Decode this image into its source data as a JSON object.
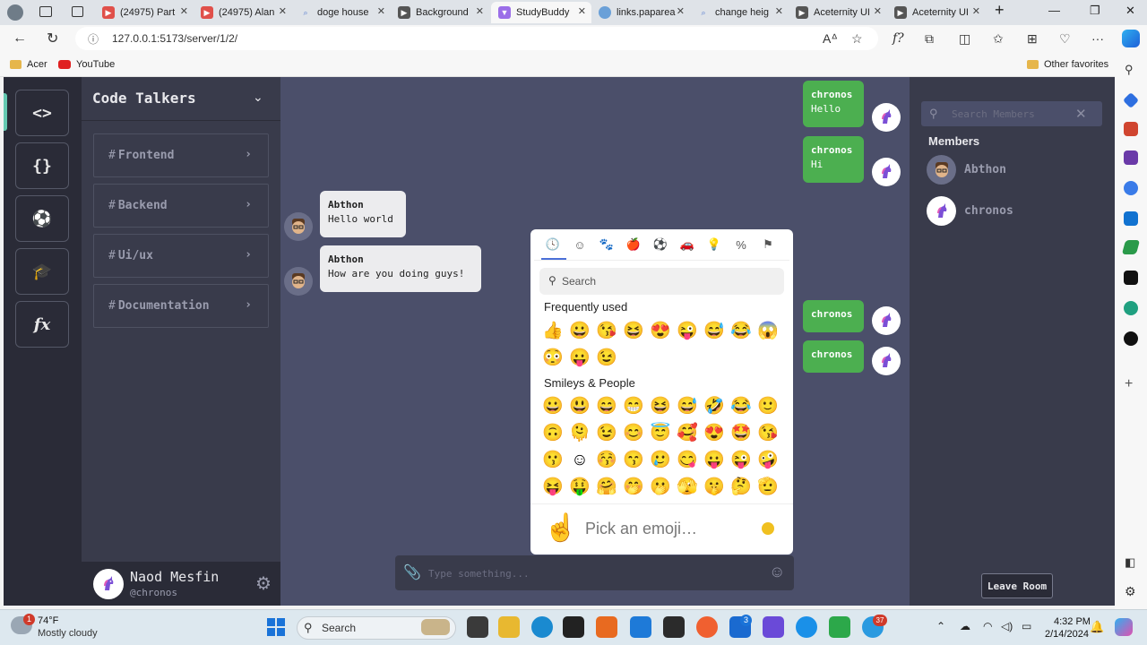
{
  "browser": {
    "tabs": [
      {
        "label": "(24975) Part",
        "icon_color": "#e0504a"
      },
      {
        "label": "(24975) Alan",
        "icon_color": "#e0504a"
      },
      {
        "label": "doge house",
        "icon_color": "#5a7fd0"
      },
      {
        "label": "Background",
        "icon_color": "#555555"
      },
      {
        "label": "StudyBuddy",
        "icon_color": "#9b6ee8"
      },
      {
        "label": "links.paparea",
        "icon_color": "#6aa0d8"
      },
      {
        "label": "change heig",
        "icon_color": "#5a7fd0"
      },
      {
        "label": "Aceternity UI",
        "icon_color": "#555555"
      },
      {
        "label": "Aceternity UI",
        "icon_color": "#555555"
      }
    ],
    "url": "127.0.0.1:5173/server/1/2/",
    "bookmarks": [
      "Acer",
      "YouTube"
    ],
    "other_favorites": "Other favorites"
  },
  "rail": {
    "buttons": [
      {
        "glyph": "<>",
        "icon": "code-icon"
      },
      {
        "glyph": "{}",
        "icon": "braces-icon"
      },
      {
        "glyph": "⚽",
        "icon": "soccer-ball-icon"
      },
      {
        "glyph": "🎓",
        "icon": "graduation-cap-icon"
      },
      {
        "glyph": "fx",
        "icon": "function-icon"
      }
    ]
  },
  "server": {
    "name": "Code Talkers",
    "channels": [
      "Frontend",
      "Backend",
      "Ui/ux",
      "Documentation"
    ]
  },
  "user": {
    "name": "Naod Mesfin",
    "handle": "@chronos"
  },
  "messages": [
    {
      "sender": "chronos",
      "text": "Hello",
      "mine": true
    },
    {
      "sender": "chronos",
      "text": "Hi",
      "mine": true
    },
    {
      "sender": "Abthon",
      "text": "Hello world",
      "mine": false
    },
    {
      "sender": "Abthon",
      "text": "How are you doing guys!",
      "mine": false
    },
    {
      "sender": "chronos",
      "text": "",
      "mine": true
    },
    {
      "sender": "chronos",
      "text": "",
      "mine": true
    }
  ],
  "composer": {
    "placeholder": "Type something..."
  },
  "emoji_picker": {
    "search_placeholder": "Search",
    "frequently_used_label": "Frequently used",
    "frequently_used": [
      "👍",
      "😀",
      "😘",
      "😆",
      "😍",
      "😜",
      "😅",
      "😂",
      "😱",
      "😳",
      "😛",
      "😉"
    ],
    "smileys_label": "Smileys & People",
    "smileys": [
      "😀",
      "😃",
      "😄",
      "😁",
      "😆",
      "😅",
      "🤣",
      "😂",
      "🙂",
      "🙃",
      "🫠",
      "😉",
      "😊",
      "😇",
      "🥰",
      "😍",
      "🤩",
      "😘",
      "😗",
      "☺",
      "😚",
      "😙",
      "🥲",
      "😋",
      "😛",
      "😜",
      "🤪",
      "😝",
      "🤑",
      "🤗",
      "🤭",
      "🫢",
      "🫣",
      "🤫",
      "🤔",
      "🫡"
    ],
    "footer_text": "Pick an emoji…",
    "preview": "☝"
  },
  "members": {
    "search_placeholder": "Search Members",
    "title": "Members",
    "list": [
      "Abthon",
      "chronos"
    ],
    "leave_label": "Leave Room"
  },
  "taskbar": {
    "weather_temp": "74°F",
    "weather_desc": "Mostly cloudy",
    "search_label": "Search",
    "time": "4:32 PM",
    "date": "2/14/2024",
    "weather_badge": "1",
    "vscode_badge": "3",
    "telegram_badge": "37"
  }
}
